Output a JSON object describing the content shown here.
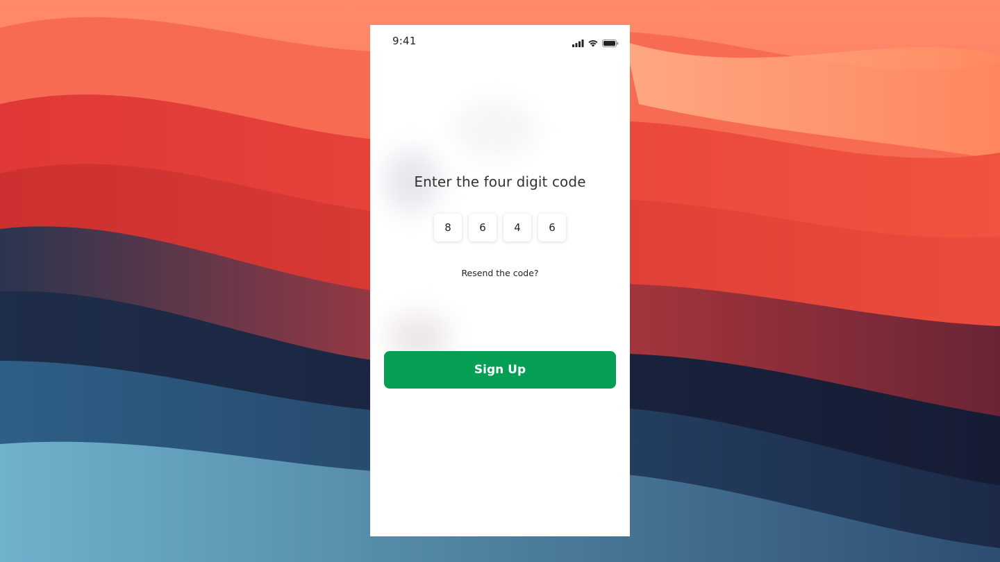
{
  "status_bar": {
    "time": "9:41",
    "icons": [
      "cellular-signal-icon",
      "wifi-icon",
      "battery-icon"
    ]
  },
  "verification": {
    "heading": "Enter the four digit code",
    "digits": [
      "8",
      "6",
      "4",
      "6"
    ],
    "resend_label": "Resend the code?"
  },
  "actions": {
    "signup_label": "Sign Up"
  },
  "colors": {
    "accent": "#059e55",
    "background_warm": "#e8453a",
    "background_cool": "#1d2b4a"
  }
}
